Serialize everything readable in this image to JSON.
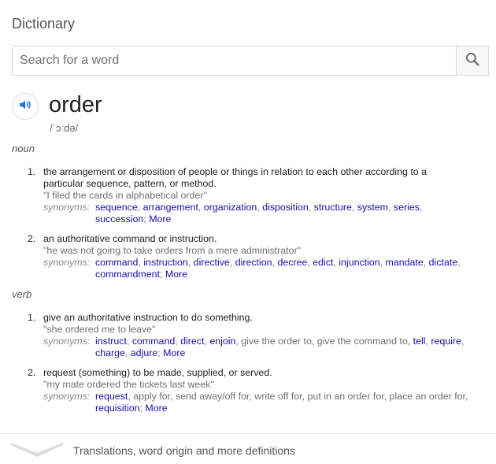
{
  "header": {
    "title": "Dictionary"
  },
  "search": {
    "placeholder": "Search for a word",
    "value": ""
  },
  "entry": {
    "word": "order",
    "phonetic": "/ˈɔːdə/",
    "noun_label": "noun",
    "verb_label": "verb",
    "senses": [
      {
        "num": "1.",
        "definition_lines": [
          "the arrangement or disposition of people or things in relation to each other according to a",
          "particular sequence, pattern, or method."
        ],
        "example": "\"I filed the cards in alphabetical order\"",
        "synonyms_label": "synonyms:",
        "synonyms_lines": [
          [
            {
              "t": "sequence",
              "link": true
            },
            {
              "t": ", ",
              "link": false
            },
            {
              "t": "arrangement",
              "link": true
            },
            {
              "t": ", ",
              "link": false
            },
            {
              "t": "organization",
              "link": true
            },
            {
              "t": ", ",
              "link": false
            },
            {
              "t": "disposition",
              "link": true
            },
            {
              "t": ", ",
              "link": false
            },
            {
              "t": "structure",
              "link": true
            },
            {
              "t": ", ",
              "link": false
            },
            {
              "t": "system",
              "link": true
            },
            {
              "t": ", ",
              "link": false
            },
            {
              "t": "series",
              "link": true
            },
            {
              "t": ",",
              "link": false
            }
          ],
          [
            {
              "t": "succession",
              "link": true
            },
            {
              "t": ";  ",
              "link": false
            }
          ]
        ],
        "more": "More"
      },
      {
        "num": "2.",
        "definition_lines": [
          "an authoritative command or instruction."
        ],
        "example": "\"he was not going to take orders from a mere administrator\"",
        "synonyms_label": "synonyms:",
        "synonyms_lines": [
          [
            {
              "t": "command",
              "link": true
            },
            {
              "t": ", ",
              "link": false
            },
            {
              "t": "instruction",
              "link": true
            },
            {
              "t": ", ",
              "link": false
            },
            {
              "t": "directive",
              "link": true
            },
            {
              "t": ", ",
              "link": false
            },
            {
              "t": "direction",
              "link": true
            },
            {
              "t": ", ",
              "link": false
            },
            {
              "t": "decree",
              "link": true
            },
            {
              "t": ", ",
              "link": false
            },
            {
              "t": "edict",
              "link": true
            },
            {
              "t": ", ",
              "link": false
            },
            {
              "t": "injunction",
              "link": true
            },
            {
              "t": ", ",
              "link": false
            },
            {
              "t": "mandate",
              "link": true
            },
            {
              "t": ", ",
              "link": false
            },
            {
              "t": "dictate",
              "link": true
            },
            {
              "t": ",",
              "link": false
            }
          ],
          [
            {
              "t": "commandment",
              "link": true
            },
            {
              "t": ";  ",
              "link": false
            }
          ]
        ],
        "more": "More"
      },
      {
        "num": "1.",
        "definition_lines": [
          "give an authoritative instruction to do something."
        ],
        "example": "\"she ordered me to leave\"",
        "synonyms_label": "synonyms:",
        "synonyms_lines": [
          [
            {
              "t": "instruct",
              "link": true
            },
            {
              "t": ", ",
              "link": false
            },
            {
              "t": "command",
              "link": true
            },
            {
              "t": ", ",
              "link": false
            },
            {
              "t": "direct",
              "link": true
            },
            {
              "t": ", ",
              "link": false
            },
            {
              "t": "enjoin",
              "link": true
            },
            {
              "t": ", give the order to, give the command to, ",
              "link": false
            },
            {
              "t": "tell",
              "link": true
            },
            {
              "t": ", ",
              "link": false
            },
            {
              "t": "require",
              "link": true
            },
            {
              "t": ",",
              "link": false
            }
          ],
          [
            {
              "t": "charge",
              "link": true
            },
            {
              "t": ", ",
              "link": false
            },
            {
              "t": "adjure",
              "link": true
            },
            {
              "t": ";  ",
              "link": false
            }
          ]
        ],
        "more": "More"
      },
      {
        "num": "2.",
        "definition_lines": [
          "request (something) to be made, supplied, or served."
        ],
        "example": "\"my mate ordered the tickets last week\"",
        "synonyms_label": "synonyms:",
        "synonyms_lines": [
          [
            {
              "t": "request",
              "link": true
            },
            {
              "t": ", apply for, send away/off for, write off for, put in an order for, place an order for,",
              "link": false
            }
          ],
          [
            {
              "t": "requisition",
              "link": true
            },
            {
              "t": ";  ",
              "link": false
            }
          ]
        ],
        "more": "More"
      }
    ]
  },
  "footer": {
    "text": "Translations, word origin and more definitions"
  },
  "colors": {
    "link": "#1a0dab",
    "speaker_icon": "#1a73e8",
    "muted": "#6f6f6f"
  },
  "icons": {
    "search": "search-icon",
    "speaker": "speaker-icon",
    "expand": "chevron-down-icon"
  }
}
